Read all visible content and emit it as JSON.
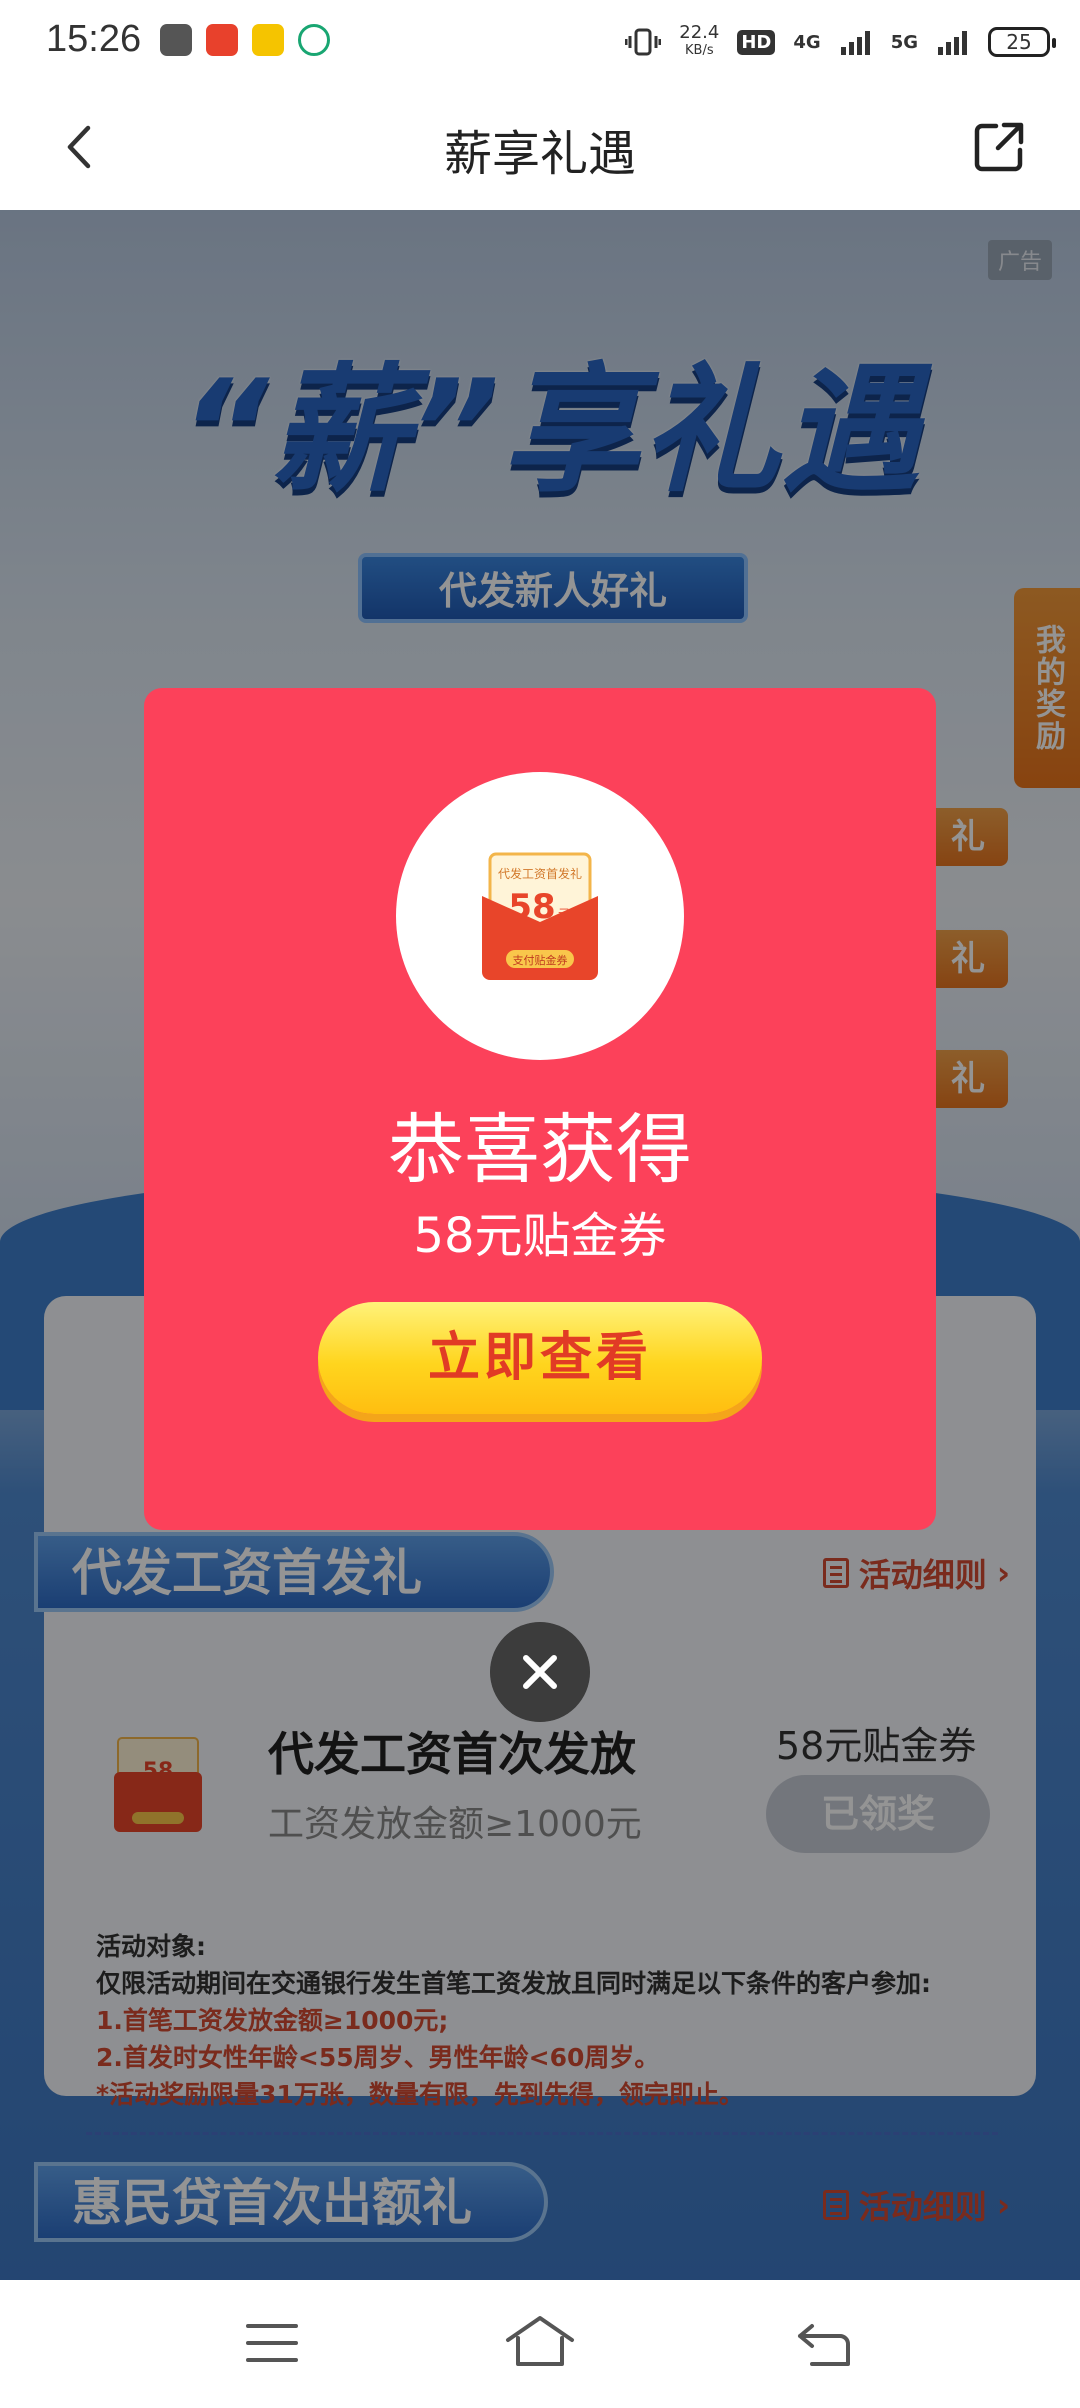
{
  "status": {
    "time": "15:26",
    "net_speed": "22.4",
    "net_unit": "KB/s",
    "hd": "HD",
    "sig1": "4G",
    "sig2": "5G",
    "battery": "25"
  },
  "nav": {
    "title": "薪享礼遇"
  },
  "hero": {
    "ad_tag": "广告",
    "title": "“薪”享礼遇",
    "subtitle": "代发新人好礼",
    "my_prize": "我的奖励",
    "side_tags": [
      "礼",
      "礼",
      "礼"
    ]
  },
  "card1": {
    "banner": "代发工资首发礼",
    "rules_link": "活动细则",
    "task_title": "代发工资首次发放",
    "task_condition": "工资发放金额≥1000元",
    "task_reward": "58元贴金券",
    "claimed_label": "已领奖",
    "rules": {
      "heading": "活动对象:",
      "line1": "仅限活动期间在交通银行发生首笔工资发放且同时满足以下条件的客户参加:",
      "line2": "1.首笔工资发放金额≥1000元;",
      "line3": "2.首发时女性年龄<55周岁、男性年龄<60周岁。",
      "line4": "*活动奖励限量31万张，数量有限，先到先得，领完即止。"
    }
  },
  "card2": {
    "banner": "惠民贷首次出额礼",
    "rules_link": "活动细则"
  },
  "coupon_icon": {
    "top": "代发工资首发礼",
    "amount": "58",
    "unit": "元",
    "bottom": "支付贴金券"
  },
  "modal": {
    "title": "恭喜获得",
    "subtitle": "58元贴金券",
    "button": "立即查看"
  },
  "colors": {
    "modal_bg": "#fc415a",
    "button_yellow": "#ffd51e",
    "brand_blue": "#2e6cc7",
    "accent_red": "#d24a33"
  }
}
